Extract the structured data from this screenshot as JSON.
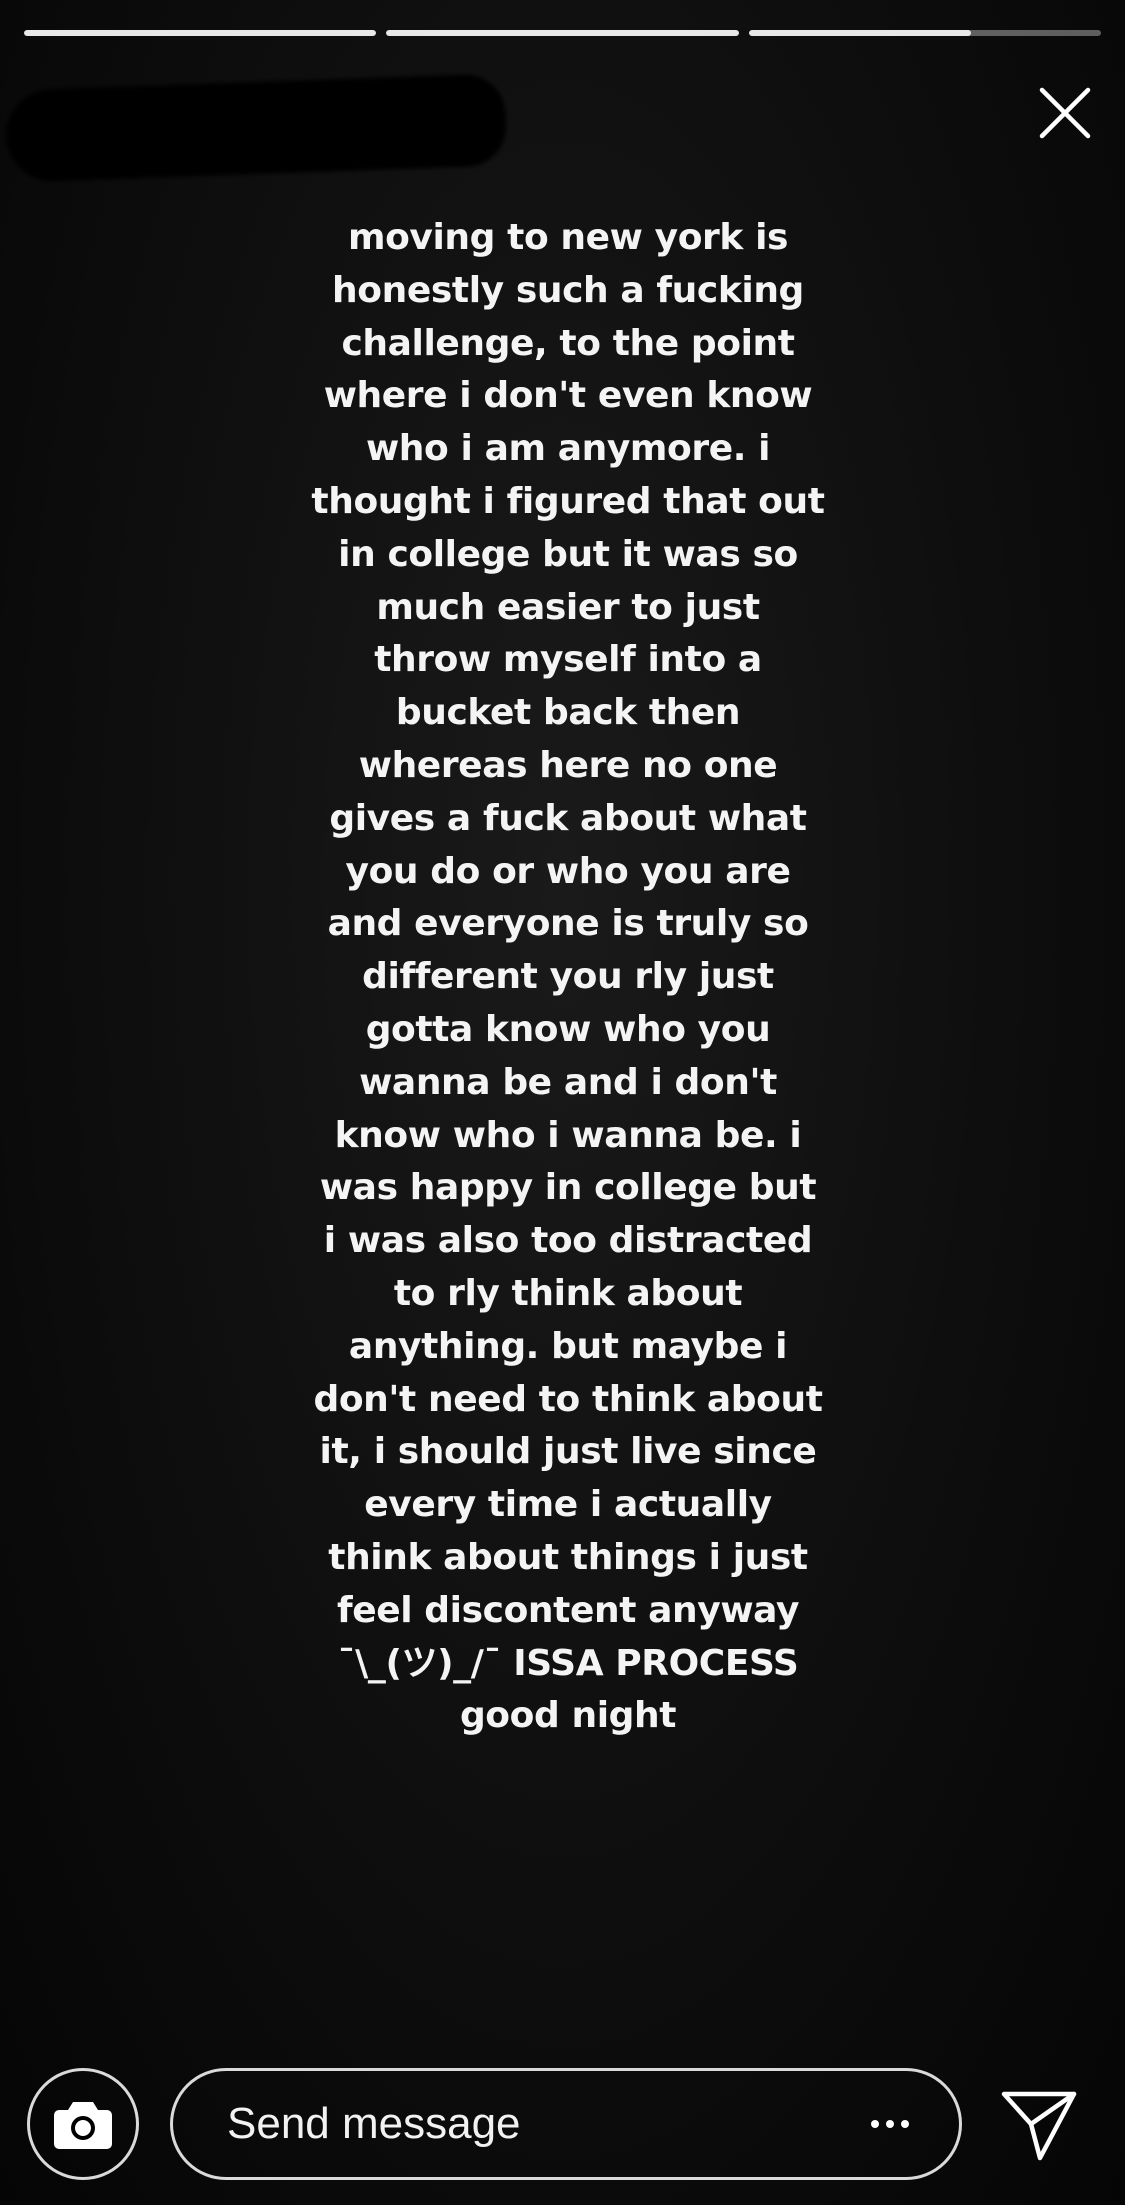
{
  "story": {
    "progress_segments": [
      1,
      1,
      0.63
    ],
    "caption": "moving to new york is\nhonestly such a fucking\nchallenge, to the point\nwhere i don't even know\nwho i am anymore. i\nthought i figured that out\nin college but it was so\nmuch easier to just\nthrow myself into a\nbucket back then\nwhereas here no one\ngives a fuck about what\nyou do or who you are\nand everyone is truly so\ndifferent you rly just\ngotta know who you\nwanna be and i don't\nknow who i wanna be. i\nwas happy in college but\ni was also too distracted\nto rly think about\nanything. but maybe i\ndon't need to think about\nit, i should just live since\nevery time i actually\nthink about things i just\nfeel discontent anyway\n¯\\_(ツ)_/¯ ISSA PROCESS\ngood night"
  },
  "header": {
    "close_icon": "close-icon"
  },
  "footer": {
    "camera_icon": "camera-icon",
    "message_placeholder": "Send message",
    "more_icon": "more-horizontal-icon",
    "send_icon": "paper-plane-icon"
  },
  "colors": {
    "background": "#000000",
    "text": "#f4f4f4",
    "progress_track": "rgba(255,255,255,0.35)",
    "progress_fill": "#e8e8e8"
  }
}
